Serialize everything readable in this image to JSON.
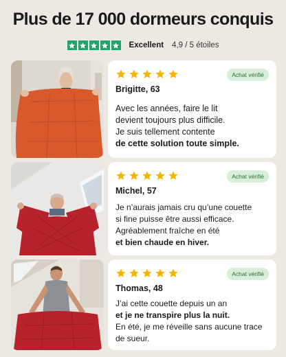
{
  "headline": "Plus de 17 000 dormeurs conquis",
  "rating": {
    "label": "Excellent",
    "score": "4,9 / 5 étoiles",
    "stars": 5,
    "star_color": "#1fa36a"
  },
  "colors": {
    "background": "#ece9e2",
    "review_star": "#f5b400",
    "badge_bg": "#d8eed9",
    "badge_text": "#2f6b3a",
    "duvet_orange": "#d85a2c",
    "duvet_red": "#b8222c"
  },
  "reviews": [
    {
      "stars": 5,
      "badge": "Achat vérifié",
      "name": "Brigitte, 63",
      "lines": [
        "Avec les années, faire le lit",
        "devient toujours plus difficile.",
        "Je suis tellement contente"
      ],
      "bold": "de cette solution toute simple."
    },
    {
      "stars": 5,
      "badge": "Achat vérifié",
      "name": "Michel, 57",
      "lines": [
        "Je n’aurais jamais cru qu’une couette",
        "si fine puisse être aussi efficace.",
        "Agréablement fraîche en été"
      ],
      "bold": "et bien chaude en hiver."
    },
    {
      "stars": 5,
      "badge": "Achat vérifié",
      "name": "Thomas, 48",
      "lines": [
        "J’ai cette couette depuis un an"
      ],
      "bold": "et je ne transpire plus la nuit.",
      "lines_after": [
        "En été, je me réveille sans aucune trace",
        "de sueur."
      ]
    }
  ]
}
